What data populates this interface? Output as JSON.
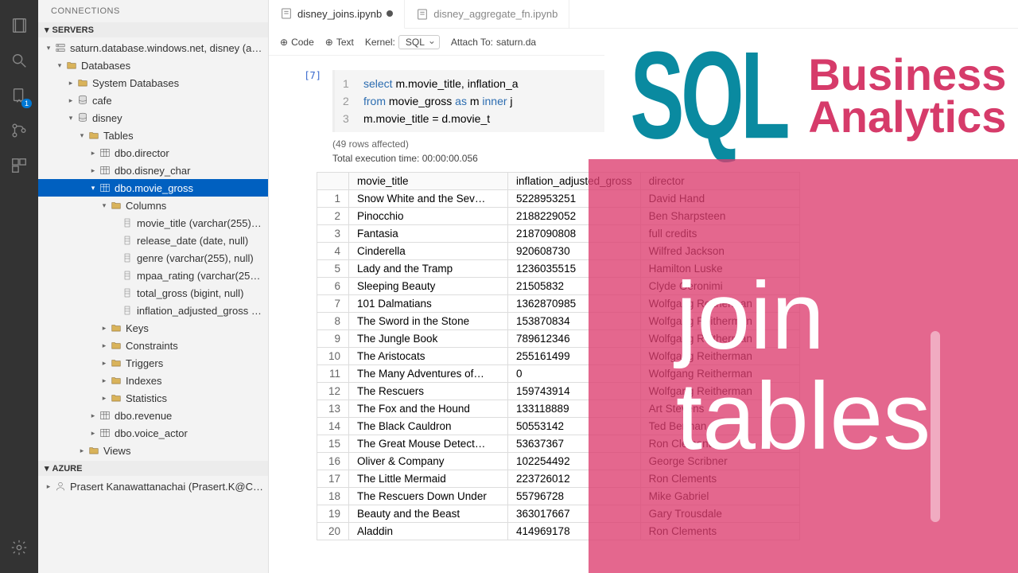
{
  "sidebar_title": "CONNECTIONS",
  "sections": {
    "servers": "SERVERS",
    "azure": "AZURE"
  },
  "server": "saturn.database.windows.net, disney (ap…",
  "databases_label": "Databases",
  "sysdb": "System Databases",
  "dbs": [
    "cafe",
    "disney"
  ],
  "tables_label": "Tables",
  "tables": [
    "dbo.director",
    "dbo.disney_char",
    "dbo.movie_gross",
    "dbo.revenue",
    "dbo.voice_actor"
  ],
  "columns_label": "Columns",
  "columns": [
    "movie_title (varchar(255), null)",
    "release_date (date, null)",
    "genre (varchar(255), null)",
    "mpaa_rating (varchar(255), null)",
    "total_gross (bigint, null)",
    "inflation_adjusted_gross (bigin…"
  ],
  "tbl_children": [
    "Keys",
    "Constraints",
    "Triggers",
    "Indexes",
    "Statistics"
  ],
  "views_label": "Views",
  "azure_user": "Prasert Kanawattanachai (Prasert.K@C…",
  "tabs": [
    {
      "label": "disney_joins.ipynb",
      "active": true,
      "dirty": true
    },
    {
      "label": "disney_aggregate_fn.ipynb",
      "active": false,
      "dirty": false
    }
  ],
  "toolbar": {
    "code": "Code",
    "text": "Text",
    "kernel_label": "Kernel:",
    "kernel_value": "SQL",
    "attach_label": "Attach To:",
    "attach_value": "saturn.da"
  },
  "cell": {
    "prompt": "[7]",
    "lines": [
      "select m.movie_title, inflation_a",
      "  from movie_gross as m inner j",
      "    m.movie_title = d.movie_t"
    ],
    "rows_affected": "(49 rows affected)",
    "exec_time": "Total execution time: 00:00:00.056"
  },
  "result": {
    "headers": [
      "movie_title",
      "inflation_adjusted_gross",
      "director"
    ],
    "rows": [
      [
        "Snow White and the Sev…",
        "5228953251",
        "David Hand"
      ],
      [
        "Pinocchio",
        "2188229052",
        "Ben Sharpsteen"
      ],
      [
        "Fantasia",
        "2187090808",
        "full credits"
      ],
      [
        "Cinderella",
        "920608730",
        "Wilfred Jackson"
      ],
      [
        "Lady and the Tramp",
        "1236035515",
        "Hamilton Luske"
      ],
      [
        "Sleeping Beauty",
        "21505832",
        "Clyde Geronimi"
      ],
      [
        "101 Dalmatians",
        "1362870985",
        "Wolfgang Reitherman"
      ],
      [
        "The Sword in the Stone",
        "153870834",
        "Wolfgang Reitherman"
      ],
      [
        "The Jungle Book",
        "789612346",
        "Wolfgang Reitherman"
      ],
      [
        "The Aristocats",
        "255161499",
        "Wolfgang Reitherman"
      ],
      [
        "The Many Adventures of…",
        "0",
        "Wolfgang Reitherman"
      ],
      [
        "The Rescuers",
        "159743914",
        "Wolfgang Reitherman"
      ],
      [
        "The Fox and the Hound",
        "133118889",
        "Art Stevens"
      ],
      [
        "The Black Cauldron",
        "50553142",
        "Ted Berman"
      ],
      [
        "The Great Mouse Detect…",
        "53637367",
        "Ron Clements"
      ],
      [
        "Oliver & Company",
        "102254492",
        "George Scribner"
      ],
      [
        "The Little Mermaid",
        "223726012",
        "Ron Clements"
      ],
      [
        "The Rescuers Down Under",
        "55796728",
        "Mike Gabriel"
      ],
      [
        "Beauty and the Beast",
        "363017667",
        "Gary Trousdale"
      ],
      [
        "Aladdin",
        "414969178",
        "Ron Clements"
      ]
    ]
  },
  "branding": {
    "sql": "SQL",
    "line1": "Business",
    "line2": "Analytics"
  },
  "overlay": {
    "line1": "join",
    "line2": "tables"
  }
}
